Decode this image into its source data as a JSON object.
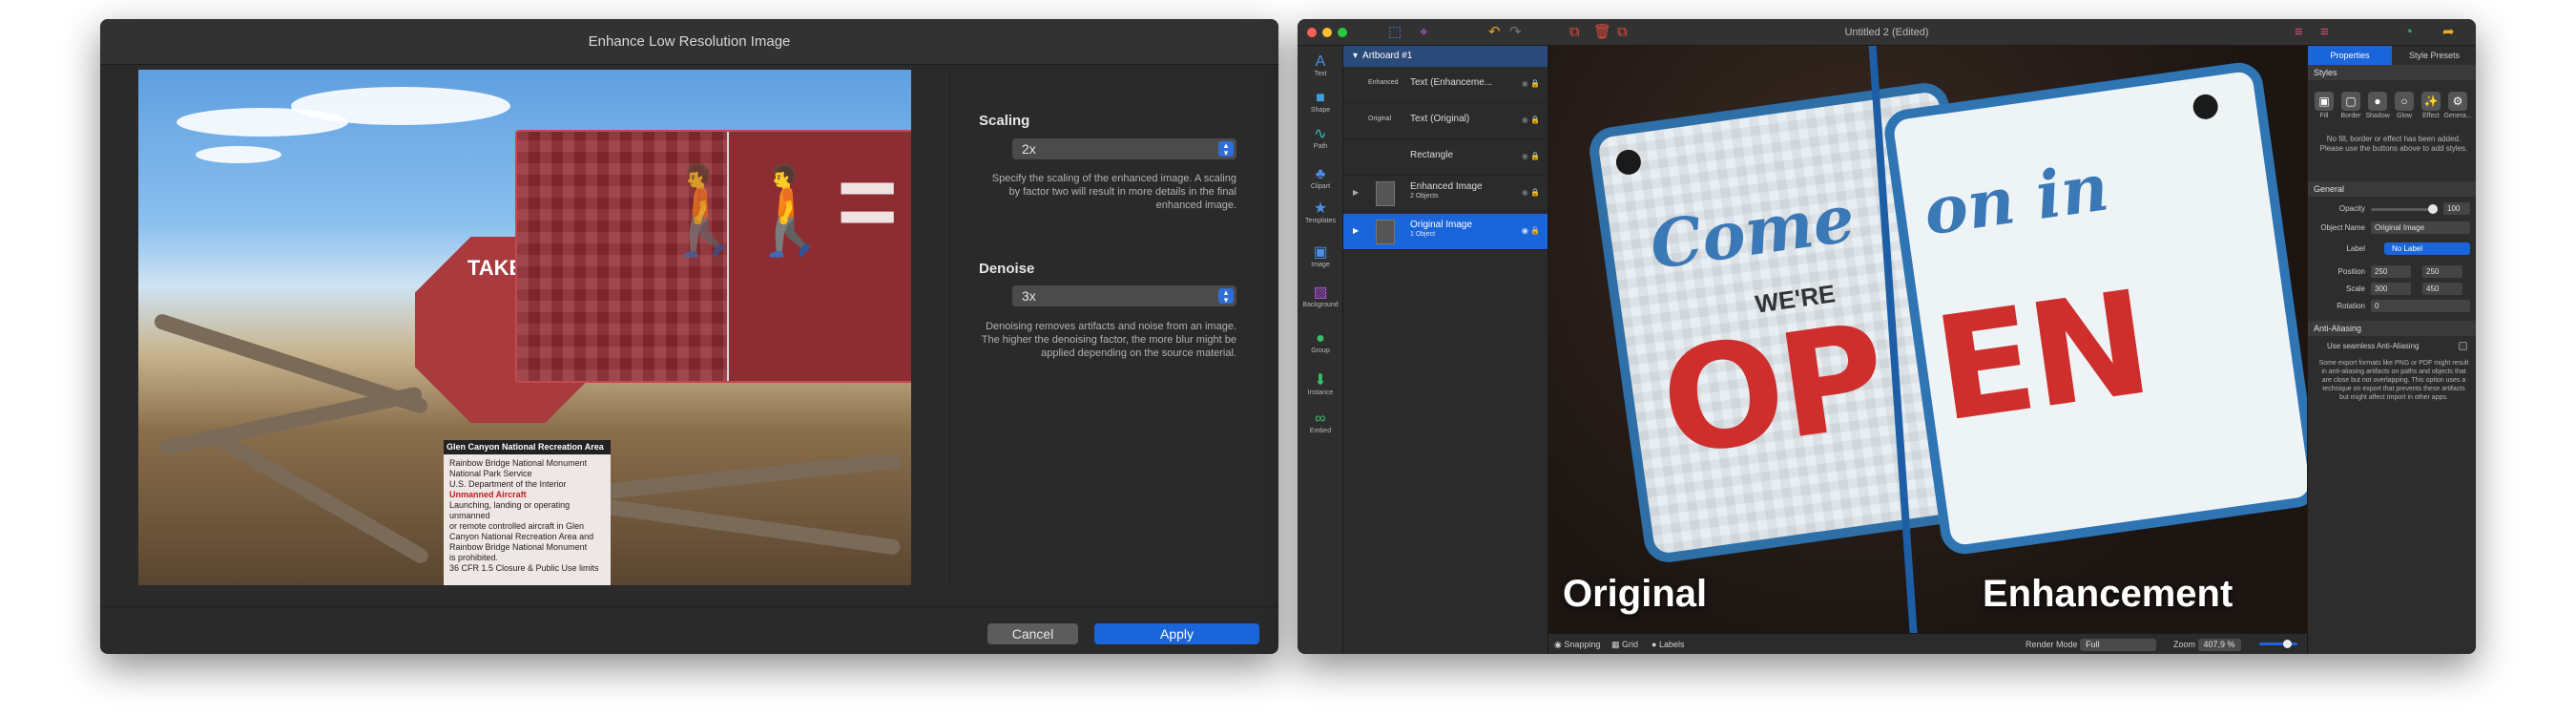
{
  "dialog": {
    "title": "Enhance Low Resolution Image",
    "scaling": {
      "label": "Scaling",
      "value": "2x",
      "help": "Specify the scaling of the enhanced image. A scaling by factor two will result in more details in the final enhanced image."
    },
    "denoise": {
      "label": "Denoise",
      "value": "3x",
      "help": "Denoising removes artifacts and noise from an image. The higher the denoising factor, the more blur might be applied depending on the source material."
    },
    "cancel_label": "Cancel",
    "apply_label": "Apply",
    "preview": {
      "sign_text": "TAKE W",
      "notice_lines": [
        "Glen Canyon National Recreation Area",
        "Rainbow Bridge National Monument",
        "National Park Service",
        "U.S. Department of the Interior",
        "Unmanned Aircraft",
        "Launching, landing or operating unmanned",
        "or remote controlled aircraft in Glen",
        "Canyon National Recreation Area and",
        "Rainbow Bridge National Monument",
        "is prohibited.",
        "36 CFR 1.5 Closure & Public Use limits"
      ]
    }
  },
  "app": {
    "document_title": "Untitled 2",
    "document_state": "(Edited)",
    "tools": [
      "Text",
      "Shape",
      "Path",
      "Clipart",
      "Templates",
      "Image",
      "Background",
      "Group",
      "Instance",
      "Embed"
    ],
    "artboard": "Artboard #1",
    "layers": [
      {
        "tag": "Enhanced",
        "name": "Text (Enhanceme...",
        "sub": ""
      },
      {
        "tag": "Original",
        "name": "Text (Original)",
        "sub": ""
      },
      {
        "tag": "",
        "name": "Rectangle",
        "sub": ""
      },
      {
        "tag": "",
        "name": "Enhanced Image",
        "sub": "2 Objects"
      },
      {
        "tag": "",
        "name": "Original Image",
        "sub": "1 Object",
        "selected": true
      }
    ],
    "canvas": {
      "label_original": "Original",
      "label_enhancement": "Enhancement",
      "sign_script_left": "Come",
      "sign_script_right": "on in",
      "sign_were": "WE'RE",
      "sign_open_left": "OP",
      "sign_open_right": "EN"
    },
    "statusbar": {
      "snapping": "Snapping",
      "grid": "Grid",
      "labels": "Labels",
      "render_mode_label": "Render Mode",
      "render_mode_value": "Full",
      "zoom_label": "Zoom",
      "zoom_value": "407,9 %"
    },
    "properties": {
      "tab_properties": "Properties",
      "tab_style_presets": "Style Presets",
      "styles_header": "Styles",
      "styles": [
        "Fill",
        "Border",
        "Shadow",
        "Glow",
        "Effect",
        "Genera..."
      ],
      "styles_message": "No fill, border or effect has been added. Please use the buttons above to add styles.",
      "general_header": "General",
      "opacity_label": "Opacity",
      "opacity_value": "100",
      "object_name_label": "Object Name",
      "object_name_value": "Original Image",
      "label_label": "Label",
      "label_value": "No Label",
      "position_label": "Position",
      "position_x": "250",
      "position_y": "250",
      "scale_label": "Scale",
      "scale_x": "300",
      "scale_y": "450",
      "rotation_label": "Rotation",
      "rotation_value": "0",
      "aa_header": "Anti-Aliasing",
      "aa_checkbox": "Use seamless Anti-Aliasing",
      "aa_help": "Some export formats like PNG or PDF might result in anti-aliasing artifacts on paths and objects that are close but not overlapping. This option uses a technique on export that prevents these artifacts but might affect Import in other apps."
    }
  },
  "colors": {
    "accent": "#1a65d9",
    "dialog_bg": "#2a2a2a",
    "sign_red": "#cf2f2c",
    "sign_blue": "#2f74b3"
  }
}
